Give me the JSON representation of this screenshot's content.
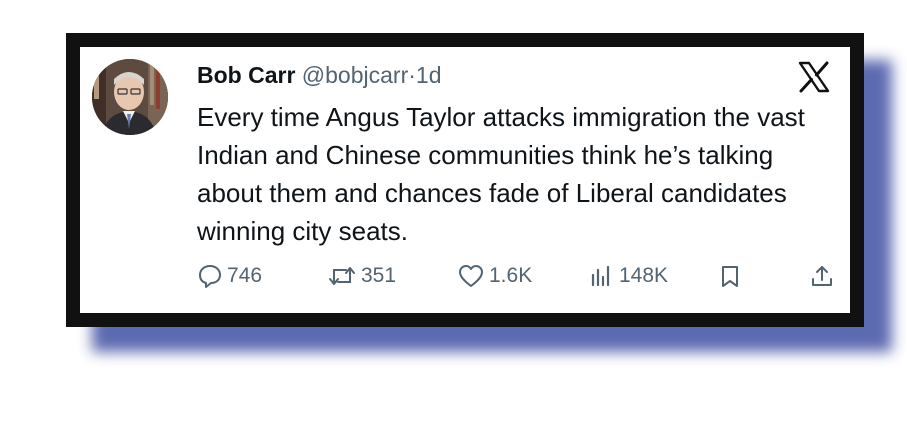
{
  "tweet": {
    "display_name": "Bob Carr",
    "handle": "@bobjcarr",
    "separator": "·",
    "time": "1d",
    "text": "Every time Angus Taylor attacks immigration the vast Indian and Chinese communities think he’s talking about them and chances fade of Liberal candidates winning city seats."
  },
  "metrics": {
    "replies": "746",
    "reposts": "351",
    "likes": "1.6K",
    "views": "148K"
  },
  "colors": {
    "frame": "#111111",
    "shadow": "#4b5aa8",
    "text": "#0f1419",
    "muted": "#536471"
  },
  "icons": [
    "x-logo-icon",
    "reply-icon",
    "repost-icon",
    "like-icon",
    "views-icon",
    "bookmark-icon",
    "share-icon"
  ]
}
